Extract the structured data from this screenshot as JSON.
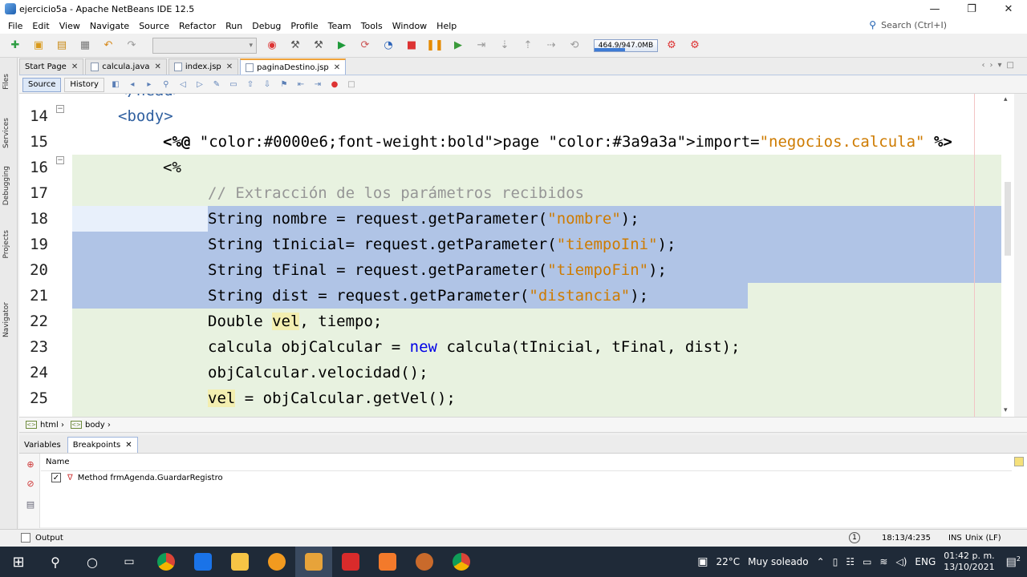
{
  "window": {
    "title": "ejercicio5a - Apache NetBeans IDE 12.5",
    "minimize": "—",
    "maximize": "❐",
    "close": "✕"
  },
  "menu": [
    "File",
    "Edit",
    "View",
    "Navigate",
    "Source",
    "Refactor",
    "Run",
    "Debug",
    "Profile",
    "Team",
    "Tools",
    "Window",
    "Help"
  ],
  "search": {
    "placeholder": "Search (Ctrl+I)"
  },
  "toolbar": {
    "memory": "464.9/947.0MB",
    "memory_fraction": 0.49
  },
  "left_strip": [
    "Files",
    "Services",
    "Debugging",
    "Projects",
    "Navigator"
  ],
  "tabs": [
    {
      "label": "Start Page",
      "active": false
    },
    {
      "label": "calcula.java",
      "active": false
    },
    {
      "label": "index.jsp",
      "active": false
    },
    {
      "label": "paginaDestino.jsp",
      "active": true
    }
  ],
  "editor_tabs": {
    "source": "Source",
    "history": "History"
  },
  "code": {
    "top_partial": "</head>",
    "lines": [
      {
        "n": "14",
        "text": "<body>"
      },
      {
        "n": "15",
        "text": "<%@ page import=\"negocios.calcula\" %>"
      },
      {
        "n": "16",
        "text": "<%"
      },
      {
        "n": "17",
        "text": "// Extracción de los parámetros recibidos"
      },
      {
        "n": "18",
        "text": "String nombre = request.getParameter(\"nombre\");"
      },
      {
        "n": "19",
        "text": "String tInicial= request.getParameter(\"tiempoIni\");"
      },
      {
        "n": "20",
        "text": "String tFinal = request.getParameter(\"tiempoFin\");"
      },
      {
        "n": "21",
        "text": "String dist = request.getParameter(\"distancia\");"
      },
      {
        "n": "22",
        "text": "Double vel, tiempo;"
      },
      {
        "n": "23",
        "text": "calcula objCalcular = new calcula(tInicial, tFinal, dist);"
      },
      {
        "n": "24",
        "text": "objCalcular.velocidad();"
      },
      {
        "n": "25",
        "text": "vel = objCalcular.getVel();"
      }
    ]
  },
  "breadcrumb": [
    "html",
    "body"
  ],
  "bottom_tabs": [
    {
      "label": "Variables"
    },
    {
      "label": "Breakpoints"
    }
  ],
  "breakpoints": {
    "header": "Name",
    "rows": [
      "Method frmAgenda.GuardarRegistro"
    ]
  },
  "status": {
    "output": "Output",
    "notif": "1",
    "position": "18:13/4:235",
    "mode": "INS",
    "eol": "Unix (LF)"
  },
  "taskbar": {
    "weather_temp": "22°C",
    "weather_text": "Muy soleado",
    "lang": "ENG",
    "time": "01:42 p. m.",
    "date": "13/10/2021",
    "notif_count": "2"
  },
  "colors": {
    "embedded_bg": "#e8f2e0",
    "selection": "#b0c4e6",
    "keyword": "#0000e6",
    "string": "#ce7b00",
    "comment": "#969696",
    "tag": "#3060a0"
  }
}
